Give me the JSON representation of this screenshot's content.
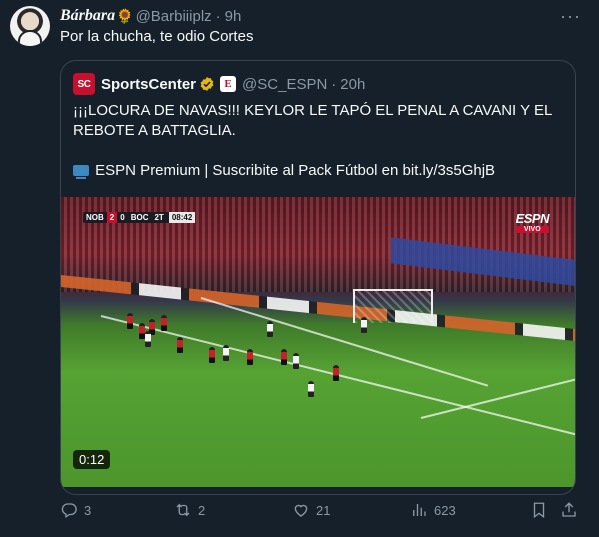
{
  "tweet": {
    "author_name": "Bárbara",
    "author_emoji": "🌻",
    "handle": "@Barbiiiplz",
    "separator": "·",
    "time": "9h",
    "more": "···",
    "text": "Por la chucha, te odio Cortes"
  },
  "quote": {
    "logo": "SC",
    "author_name": "SportsCenter",
    "affiliate_badge": "E",
    "handle": "@SC_ESPN",
    "separator": "·",
    "time": "20h",
    "text_line1": "¡¡¡LOCURA DE NAVAS!!! KEYLOR LE TAPÓ EL PENAL A CAVANI Y EL REBOTE A BATTAGLIA.",
    "text_line2": "ESPN Premium | Suscribite al Pack Fútbol en bit.ly/3s5GhjB",
    "video": {
      "duration": "0:12",
      "score_home": "NOB",
      "score_home_goals": "2",
      "score_away_goals": "0",
      "score_away": "BOC",
      "period": "2T",
      "clock": "08:42",
      "network": "ESPN",
      "live": "VIVO"
    }
  },
  "actions": {
    "replies": "3",
    "reposts": "2",
    "likes": "21",
    "views": "623"
  },
  "colors": {
    "background": "#15202b",
    "text": "#f7f9f9",
    "muted": "#8b98a5",
    "border": "#38444d",
    "verified_gold": "#e2b719",
    "brand_red": "#c8102e"
  },
  "icons": [
    "more-icon",
    "verified-icon",
    "tv-icon",
    "reply-icon",
    "repost-icon",
    "like-icon",
    "views-icon",
    "bookmark-icon",
    "share-icon"
  ]
}
